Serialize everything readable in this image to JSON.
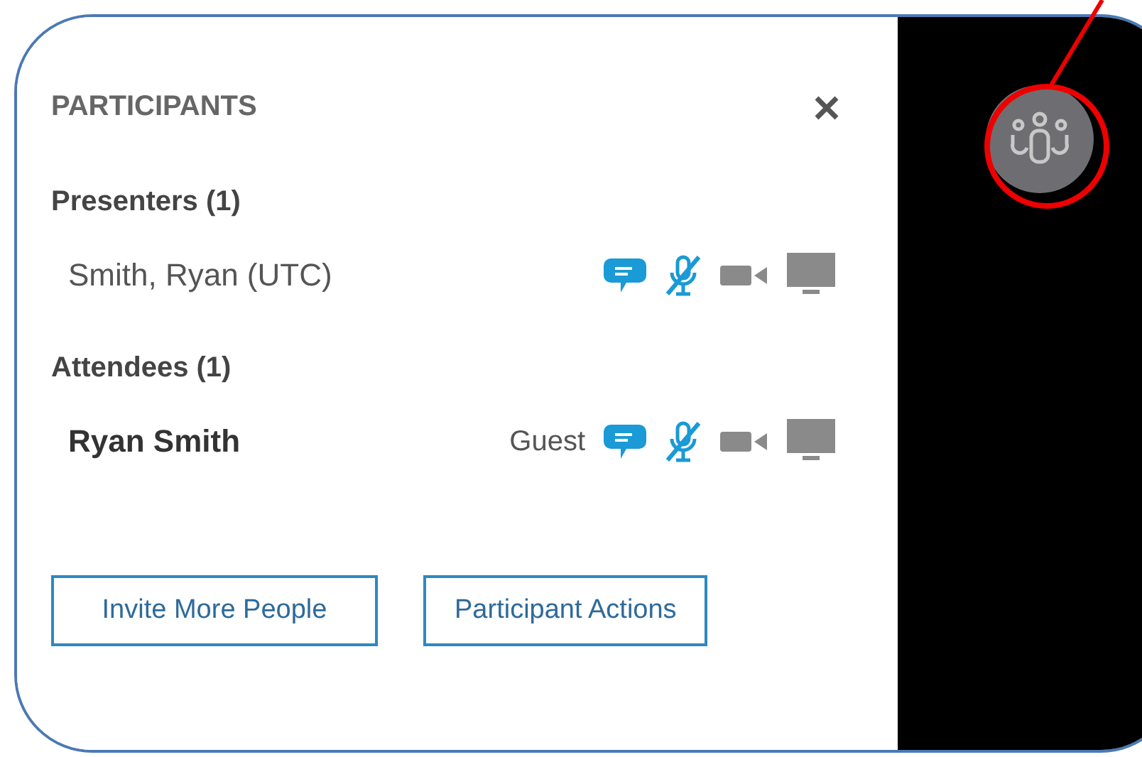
{
  "panel": {
    "title": "PARTICIPANTS"
  },
  "groups": [
    {
      "heading": "Presenters (1)",
      "participants": [
        {
          "name": "Smith, Ryan (UTC)",
          "bold": false
        }
      ]
    },
    {
      "heading": "Attendees (1)",
      "participants": [
        {
          "name": "Ryan Smith",
          "bold": true,
          "role": "Guest"
        }
      ]
    }
  ],
  "buttons": [
    "Invite More People",
    "Participant Actions"
  ]
}
